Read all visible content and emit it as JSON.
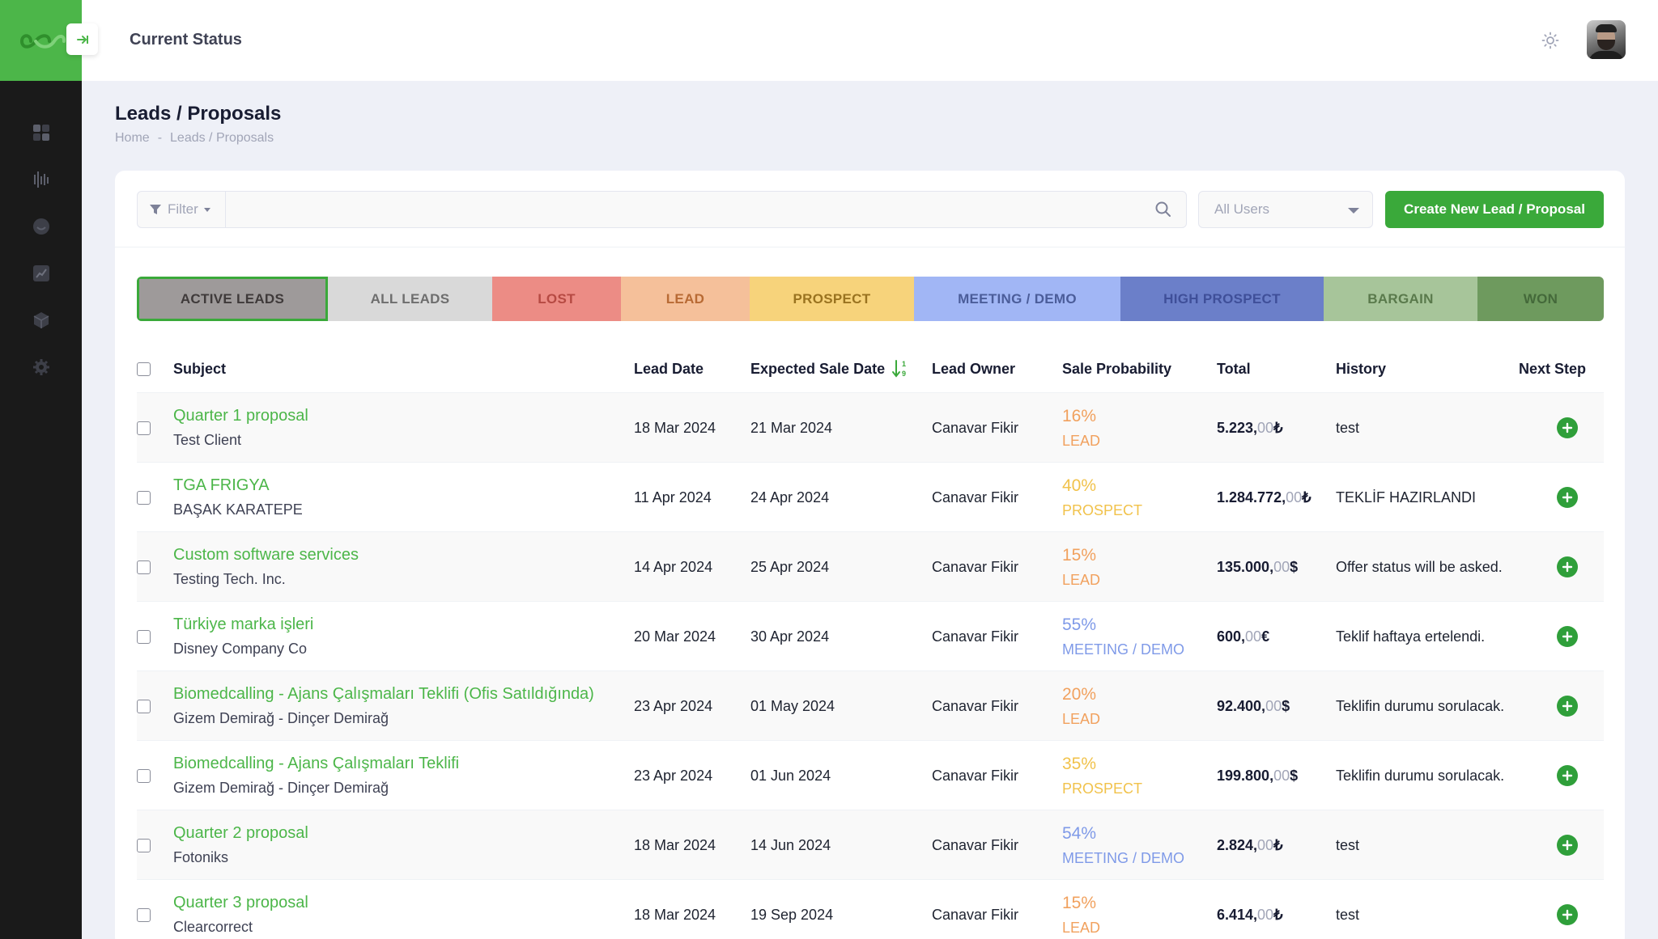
{
  "header": {
    "title": "Current Status"
  },
  "page": {
    "title": "Leads / Proposals",
    "breadcrumb": [
      "Home",
      "-",
      "Leads / Proposals"
    ]
  },
  "toolbar": {
    "filter_label": "Filter",
    "search_placeholder": "",
    "users_select_value": "All Users",
    "create_button_label": "Create New Lead / Proposal"
  },
  "sidebar": {
    "icons": [
      "dashboard-icon",
      "chart-bars-icon",
      "face-icon",
      "report-icon",
      "box-icon",
      "settings-icon"
    ]
  },
  "tabs": [
    {
      "label": "ACTIVE LEADS",
      "bg": "#9e9a9a",
      "color": "#3f3a3a",
      "active": true
    },
    {
      "label": "ALL LEADS",
      "bg": "#d9d9d9",
      "color": "#6e6e6e",
      "active": false
    },
    {
      "label": "LOST",
      "bg": "#ec8c85",
      "color": "#b64a43",
      "active": false
    },
    {
      "label": "LEAD",
      "bg": "#f5c09a",
      "color": "#b86a34",
      "active": false
    },
    {
      "label": "PROSPECT",
      "bg": "#f7d37b",
      "color": "#9a7320",
      "active": false
    },
    {
      "label": "MEETING / DEMO",
      "bg": "#a1b6f5",
      "color": "#4b5d9a",
      "active": false
    },
    {
      "label": "HIGH PROSPECT",
      "bg": "#6b7fc9",
      "color": "#3f4f99",
      "active": false
    },
    {
      "label": "BARGAIN",
      "bg": "#a7c59a",
      "color": "#5a7a4c",
      "active": false
    },
    {
      "label": "WON",
      "bg": "#6e9a5e",
      "color": "#44693a",
      "active": false
    }
  ],
  "table": {
    "columns": {
      "subject": "Subject",
      "lead_date": "Lead Date",
      "expected_sale_date": "Expected Sale Date",
      "lead_owner": "Lead Owner",
      "sale_probability": "Sale Probability",
      "total": "Total",
      "history": "History",
      "next_step": "Next Step"
    },
    "rows": [
      {
        "subject": "Quarter 1 proposal",
        "client": "Test Client",
        "lead_date": "18 Mar 2024",
        "expected": "21 Mar 2024",
        "owner": "Canavar Fikir",
        "prob": "16%",
        "stage": "LEAD",
        "stage_color": "#f1a15e",
        "total_main": "5.223,",
        "total_dec": "00",
        "currency": "₺",
        "history": "test"
      },
      {
        "subject": "TGA FRIGYA",
        "client": "BAŞAK KARATEPE",
        "lead_date": "11 Apr 2024",
        "expected": "24 Apr 2024",
        "owner": "Canavar Fikir",
        "prob": "40%",
        "stage": "PROSPECT",
        "stage_color": "#f1c24b",
        "total_main": "1.284.772,",
        "total_dec": "00",
        "currency": "₺",
        "history": "TEKLİF HAZIRLANDI"
      },
      {
        "subject": "Custom software services",
        "client": "Testing Tech. Inc.",
        "lead_date": "14 Apr 2024",
        "expected": "25 Apr 2024",
        "owner": "Canavar Fikir",
        "prob": "15%",
        "stage": "LEAD",
        "stage_color": "#f1a15e",
        "total_main": "135.000,",
        "total_dec": "00",
        "currency": "$",
        "history": "Offer status will be asked."
      },
      {
        "subject": "Türkiye marka işleri",
        "client": "Disney Company Co",
        "lead_date": "20 Mar 2024",
        "expected": "30 Apr 2024",
        "owner": "Canavar Fikir",
        "prob": "55%",
        "stage": "MEETING / DEMO",
        "stage_color": "#7f9ae8",
        "total_main": "600,",
        "total_dec": "00",
        "currency": "€",
        "history": "Teklif haftaya ertelendi."
      },
      {
        "subject": "Biomedcalling - Ajans Çalışmaları Teklifi (Ofis Satıldığında)",
        "client": "Gizem Demirağ - Dinçer Demirağ",
        "lead_date": "23 Apr 2024",
        "expected": "01 May 2024",
        "owner": "Canavar Fikir",
        "prob": "20%",
        "stage": "LEAD",
        "stage_color": "#f1a15e",
        "total_main": "92.400,",
        "total_dec": "00",
        "currency": "$",
        "history": "Teklifin durumu sorulacak."
      },
      {
        "subject": "Biomedcalling - Ajans Çalışmaları Teklifi",
        "client": "Gizem Demirağ - Dinçer Demirağ",
        "lead_date": "23 Apr 2024",
        "expected": "01 Jun 2024",
        "owner": "Canavar Fikir",
        "prob": "35%",
        "stage": "PROSPECT",
        "stage_color": "#f1c24b",
        "total_main": "199.800,",
        "total_dec": "00",
        "currency": "$",
        "history": "Teklifin durumu sorulacak."
      },
      {
        "subject": "Quarter 2 proposal",
        "client": "Fotoniks",
        "lead_date": "18 Mar 2024",
        "expected": "14 Jun 2024",
        "owner": "Canavar Fikir",
        "prob": "54%",
        "stage": "MEETING / DEMO",
        "stage_color": "#7f9ae8",
        "total_main": "2.824,",
        "total_dec": "00",
        "currency": "₺",
        "history": "test"
      },
      {
        "subject": "Quarter 3 proposal",
        "client": "Clearcorrect",
        "lead_date": "18 Mar 2024",
        "expected": "19 Sep 2024",
        "owner": "Canavar Fikir",
        "prob": "15%",
        "stage": "LEAD",
        "stage_color": "#f1a15e",
        "total_main": "6.414,",
        "total_dec": "00",
        "currency": "₺",
        "history": "test"
      }
    ]
  },
  "colors": {
    "brand_green": "#4cb649",
    "button_green": "#3aa93a",
    "sidebar_bg": "#1a1a1a"
  }
}
